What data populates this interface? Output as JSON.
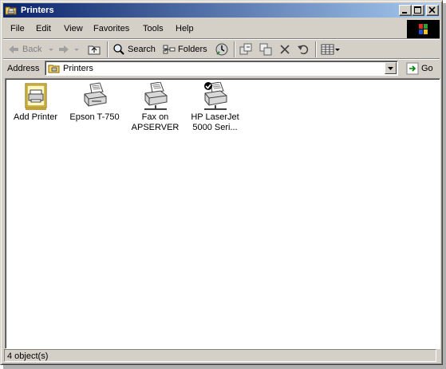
{
  "window": {
    "title": "Printers"
  },
  "menu": [
    "File",
    "Edit",
    "View",
    "Favorites",
    "Tools",
    "Help"
  ],
  "toolbar": {
    "back_label": "Back",
    "search_label": "Search",
    "folders_label": "Folders"
  },
  "address": {
    "label": "Address",
    "value": "Printers",
    "go_label": "Go"
  },
  "items": [
    {
      "label_line1": "Add Printer",
      "label_line2": ""
    },
    {
      "label_line1": "Epson T-750",
      "label_line2": ""
    },
    {
      "label_line1": "Fax on",
      "label_line2": "APSERVER"
    },
    {
      "label_line1": "HP LaserJet",
      "label_line2": "5000 Seri..."
    }
  ],
  "status": {
    "text": "4 object(s)"
  },
  "colors": {
    "titlebar_start": "#0a246a",
    "titlebar_end": "#a6caf0",
    "face": "#d4d0c8"
  }
}
